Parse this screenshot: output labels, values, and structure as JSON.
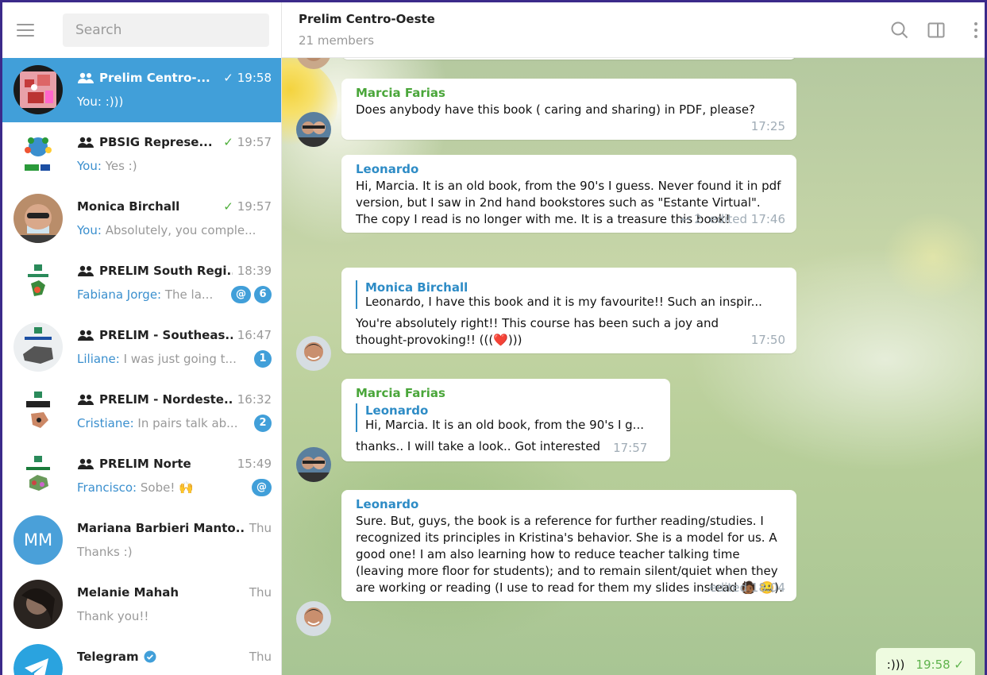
{
  "sidebar": {
    "search_placeholder": "Search",
    "chats": [
      {
        "name": "Prelim Centro-...",
        "time": "19:58",
        "check": "✓",
        "sender": "You:",
        "preview": " :)))",
        "badges": []
      },
      {
        "name": "PBSIG Represe...",
        "time": "19:57",
        "check": "✓",
        "sender": "You:",
        "preview": " Yes :)",
        "badges": []
      },
      {
        "name": "Monica Birchall",
        "time": "19:57",
        "check": "✓",
        "sender": "You:",
        "preview": " Absolutely, you comple...",
        "badges": []
      },
      {
        "name": "PRELIM South Regi...",
        "time": "18:39",
        "check": "",
        "sender": "Fabiana Jorge:",
        "preview": " The la...",
        "badges": [
          "@",
          "6"
        ]
      },
      {
        "name": "PRELIM - Southeas...",
        "time": "16:47",
        "check": "",
        "sender": "Liliane:",
        "preview": " I was just  going t...",
        "badges": [
          "1"
        ]
      },
      {
        "name": "PRELIM - Nordeste...",
        "time": "16:32",
        "check": "",
        "sender": "Cristiane:",
        "preview": " In pairs talk ab...",
        "badges": [
          "2"
        ]
      },
      {
        "name": "PRELIM Norte",
        "time": "15:49",
        "check": "",
        "sender": "Francisco:",
        "preview": " Sobe! 🙌",
        "badges": [
          "@"
        ]
      },
      {
        "name": "Mariana Barbieri Manto...",
        "time": "Thu",
        "check": "",
        "sender": "",
        "preview": "Thanks :)",
        "badges": [],
        "initials": "MM"
      },
      {
        "name": "Melanie Mahah",
        "time": "Thu",
        "check": "",
        "sender": "",
        "preview": "Thank you!!",
        "badges": []
      },
      {
        "name": "Telegram",
        "time": "Thu",
        "check": "",
        "sender": "",
        "preview": "",
        "badges": []
      }
    ]
  },
  "header": {
    "title": "Prelim Centro-Oeste",
    "subtitle": "21 members"
  },
  "messages": [
    {
      "sender": "Marcia Farias",
      "text": "Does anybody have this book ( caring and sharing) in PDF, please?",
      "meta": "17:25"
    },
    {
      "sender": "Leonardo",
      "text": "Hi, Marcia. It is an old book, from the 90's I guess. Never found it in pdf version, but I saw in 2nd hand bookstores such as \"Estante Virtual\". The copy I read is no longer with me. It is a treasure this book!",
      "meta": "edited 17:46",
      "replies": "2"
    },
    {
      "reply_name": "Monica Birchall",
      "reply_text": "Leonardo, I have this book and it is my favourite!! Such an inspir...",
      "text": "You're absolutely right!! This course has been such a joy and thought-provoking!! (((❤️)))",
      "meta": "17:50"
    },
    {
      "sender": "Marcia Farias",
      "reply_name": "Leonardo",
      "reply_text": "Hi, Marcia. It is an old book, from the 90's I g...",
      "text": "thanks.. I will take a look.. Got interested",
      "meta": "17:57"
    },
    {
      "sender": "Leonardo",
      "text": "Sure. But, guys, the book is a reference for further reading/studies. I recognized its principles in Kristina's behavior. She is a model for us. A good one! I am also learning how to reduce teacher talking time (leaving more floor for students); and to remain silent/quiet when they are working or reading (I use to read for them my slides instead 🧑🏾 🤐).",
      "meta": "edited 18:04"
    }
  ],
  "outgoing": {
    "text": ":)))",
    "meta": "19:58 ✓"
  },
  "colors": {
    "accent": "#419fd9",
    "green": "#4aa63a",
    "link": "#2e8cc6"
  }
}
